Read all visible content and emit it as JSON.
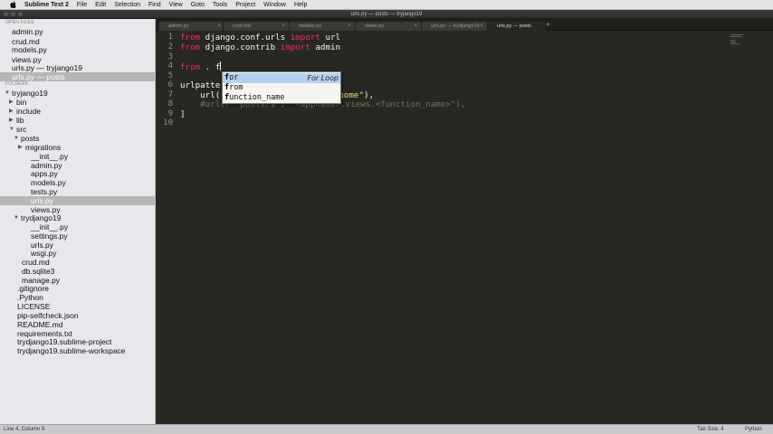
{
  "menubar": {
    "app": "Sublime Text 2",
    "items": [
      "File",
      "Edit",
      "Selection",
      "Find",
      "View",
      "Goto",
      "Tools",
      "Project",
      "Window",
      "Help"
    ]
  },
  "window": {
    "title": "urls.py — posts — tryjango19"
  },
  "sidebar": {
    "open_files_header": "OPEN FILES",
    "open_files": [
      "admin.py",
      "crud.md",
      "models.py",
      "views.py",
      "urls.py — tryjango19",
      "urls.py — posts"
    ],
    "folders_header": "FOLDERS",
    "tree": [
      {
        "label": "tryjango19",
        "arrow": "▼"
      },
      {
        "label": "bin",
        "arrow": "▶"
      },
      {
        "label": "include",
        "arrow": "▶"
      },
      {
        "label": "lib",
        "arrow": "▶"
      },
      {
        "label": "src",
        "arrow": "▼"
      },
      {
        "label": "posts",
        "arrow": "▼"
      },
      {
        "label": "migrations",
        "arrow": "▶"
      },
      {
        "label": "__init__.py",
        "arrow": ""
      },
      {
        "label": "admin.py",
        "arrow": ""
      },
      {
        "label": "apps.py",
        "arrow": ""
      },
      {
        "label": "models.py",
        "arrow": ""
      },
      {
        "label": "tests.py",
        "arrow": ""
      },
      {
        "label": "urls.py",
        "arrow": ""
      },
      {
        "label": "views.py",
        "arrow": ""
      },
      {
        "label": "trydjango19",
        "arrow": "▼"
      },
      {
        "label": "__init__.py",
        "arrow": ""
      },
      {
        "label": "settings.py",
        "arrow": ""
      },
      {
        "label": "urls.py",
        "arrow": ""
      },
      {
        "label": "wsgi.py",
        "arrow": ""
      },
      {
        "label": "crud.md",
        "arrow": ""
      },
      {
        "label": "db.sqlite3",
        "arrow": ""
      },
      {
        "label": "manage.py",
        "arrow": ""
      },
      {
        "label": ".gitignore",
        "arrow": ""
      },
      {
        "label": ".Python",
        "arrow": ""
      },
      {
        "label": "LICENSE",
        "arrow": ""
      },
      {
        "label": "pip-selfcheck.json",
        "arrow": ""
      },
      {
        "label": "README.md",
        "arrow": ""
      },
      {
        "label": "requirements.txt",
        "arrow": ""
      },
      {
        "label": "trydjango19.sublime-project",
        "arrow": ""
      },
      {
        "label": "trydjango19.sublime-workspace",
        "arrow": ""
      }
    ]
  },
  "tabs": [
    "admin.py",
    "crud.md",
    "models.py",
    "views.py",
    "urls.py — trydjango19",
    "urls.py — posts"
  ],
  "tab_close_glyph": "×",
  "new_tab_glyph": "+",
  "editor": {
    "line_numbers": [
      "1",
      "2",
      "3",
      "4",
      "5",
      "6",
      "7",
      "8",
      "9",
      "10"
    ],
    "lines": {
      "l1_kw1": "from",
      "l1_mod": " django.conf.urls ",
      "l1_kw2": "import",
      "l1_name": " url",
      "l2_kw1": "from",
      "l2_mod": " django.contrib ",
      "l2_kw2": "import",
      "l2_name": " admin",
      "l4_kw": "from",
      "l4_rest": " . f",
      "l6": "urlpatte",
      "l7_a": "    url(",
      "l7_str": "home\"",
      "l7_b": "),",
      "l8_cm": "    #url(r'^posts/$', \"<appname>.views.<function_name>\"),",
      "l9": "]"
    }
  },
  "autocomplete": {
    "items": [
      {
        "match": "f",
        "rest": "or",
        "hint": "For Loop"
      },
      {
        "match": "f",
        "rest": "rom",
        "hint": ""
      },
      {
        "match": "f",
        "rest": "unction_name",
        "hint": ""
      }
    ]
  },
  "statusbar": {
    "position": "Line 4, Column 9",
    "tab_size": "Tab Size: 4",
    "syntax": "Python"
  }
}
